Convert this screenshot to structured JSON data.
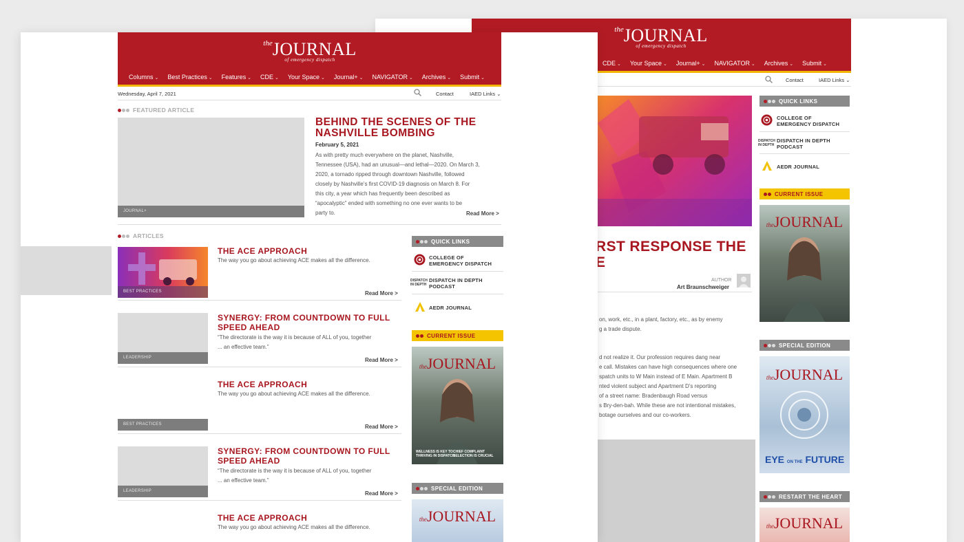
{
  "brand": {
    "the": "the",
    "journal": "JOURNAL",
    "tagline": "of emergency dispatch",
    "header_color": "#b31b24",
    "accent_color": "#f2b705"
  },
  "front": {
    "nav": [
      "Columns",
      "Best Practices",
      "Features",
      "CDE",
      "Your Space",
      "Journal+",
      "NAVIGATOR",
      "Archives",
      "Submit"
    ],
    "date": "Wednesday, April 7, 2021",
    "contact": "Contact",
    "iaed_links": "IAED Links",
    "featured_label": "FEATURED ARTICLE",
    "featured": {
      "category": "JOURNAL+",
      "title_line1": "BEHIND THE SCENES OF THE",
      "title_line2": "NASHVILLE BOMBING",
      "date": "February 5, 2021",
      "body": [
        "As with pretty much everywhere on the planet, Nashville,",
        "Tennessee (USA), had an unusual—and lethal—2020. On March 3,",
        "2020, a tornado ripped through downtown Nashville, followed",
        "closely by Nashville’s first COVID-19 diagnosis on March 8. For",
        "this city, a year which has frequently been described as",
        "“apocalyptic” ended with something no one ever wants to be",
        "party to."
      ],
      "read_more": "Read More >"
    },
    "articles_label": "ARTICLES",
    "articles": [
      {
        "category": "BEST PRACTICES",
        "title1": "THE ACE APPROACH",
        "title2": "",
        "desc1": "The way you go about achieving ACE makes all the difference.",
        "desc2": "",
        "read_more": "Read More >"
      },
      {
        "category": "LEADERSHIP",
        "title1": "SYNERGY: FROM COUNTDOWN TO FULL",
        "title2": "SPEED AHEAD",
        "desc1": "“The directorate is the way it is because of ALL of you, together",
        "desc2": "... an effective team.”",
        "read_more": "Read More >"
      },
      {
        "category": "BEST PRACTICES",
        "title1": "THE ACE APPROACH",
        "title2": "",
        "desc1": "The way you go about achieving ACE makes all the difference.",
        "desc2": "",
        "read_more": "Read More >"
      },
      {
        "category": "LEADERSHIP",
        "title1": "SYNERGY: FROM COUNTDOWN TO FULL",
        "title2": "SPEED AHEAD",
        "desc1": "“The directorate is the way it is because of ALL of you, together",
        "desc2": "... an effective team.”",
        "read_more": "Read More >"
      },
      {
        "category": "",
        "title1": "THE ACE APPROACH",
        "title2": "",
        "desc1": "The way you go about achieving ACE makes all the difference.",
        "desc2": "",
        "read_more": ""
      }
    ],
    "sidebar": {
      "quick_links": "QUICK LINKS",
      "links": [
        {
          "line1": "COLLEGE OF",
          "line2": "EMERGENCY DISPATCH"
        },
        {
          "line1": "DISPATCH IN DEPTH",
          "line2": "PODCAST"
        },
        {
          "line1": "AEDR JOURNAL",
          "line2": ""
        }
      ],
      "current_issue": "CURRENT ISSUE",
      "special_edition": "SPECIAL EDITION",
      "cover_caption1": "WELLNESS IS KEY TO",
      "cover_caption2": "THRIVING IN DISPATCH",
      "cover_caption3": "CHIEF COMPLAINT",
      "cover_caption4": "SELECTION IS CRUCIAL"
    }
  },
  "back": {
    "nav": [
      "CDE",
      "Your Space",
      "Journal+",
      "NAVIGATOR",
      "Archives",
      "Submit"
    ],
    "contact": "Contact",
    "iaed_links": "IAED Links",
    "headline1": "RST RESPONSE THE",
    "headline2": "E",
    "author_label": "AUTHOR",
    "author_name": "Art Braunschweiger",
    "body1": [
      "on, work, etc., in a plant, factory, etc., as by enemy",
      "g a trade dispute."
    ],
    "body2": [
      "d not realize it. Our profession requires dang near",
      "e call. Mistakes can have high consequences where one",
      "spatch units to W Main instead of E Main. Apartment B",
      "nted violent subject and Apartment D’s reporting",
      "of a street name: Bradenbaugh Road versus",
      "s Bry-den-bah. While these are not intentional mistakes,",
      "botage ourselves and our co-workers."
    ],
    "sidebar": {
      "quick_links": "QUICK LINKS",
      "links": [
        {
          "line1": "COLLEGE OF",
          "line2": "EMERGENCY DISPATCH"
        },
        {
          "line1": "DISPATCH IN DEPTH",
          "line2": "PODCAST"
        },
        {
          "line1": "AEDR JOURNAL",
          "line2": ""
        }
      ],
      "current_issue": "CURRENT ISSUE",
      "special_edition": "SPECIAL EDITION",
      "restart": "RESTART THE HEART",
      "eye_future1": "EYE",
      "eye_future2": "ON THE",
      "eye_future3": "FUTURE"
    }
  }
}
